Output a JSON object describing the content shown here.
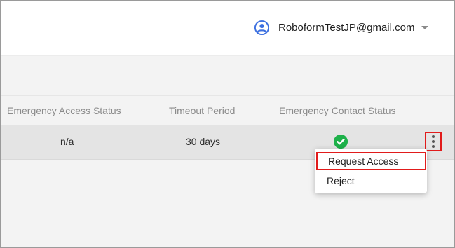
{
  "header": {
    "account_email": "RoboformTestJP@gmail.com",
    "avatar_icon": "account-circle-icon",
    "dropdown_icon": "caret-down-icon",
    "accent_color": "#3b6fe0"
  },
  "table": {
    "columns": [
      "Emergency Access Status",
      "Timeout Period",
      "Emergency Contact Status"
    ],
    "row": {
      "emergency_access_status": "n/a",
      "timeout_period": "30 days",
      "emergency_contact_status_icon": "check-circle-icon",
      "status_color": "#1eb14a",
      "actions_icon": "more-vertical-icon"
    }
  },
  "context_menu": {
    "items": [
      "Request Access",
      "Reject"
    ]
  },
  "highlight_color": "#e11b1b"
}
